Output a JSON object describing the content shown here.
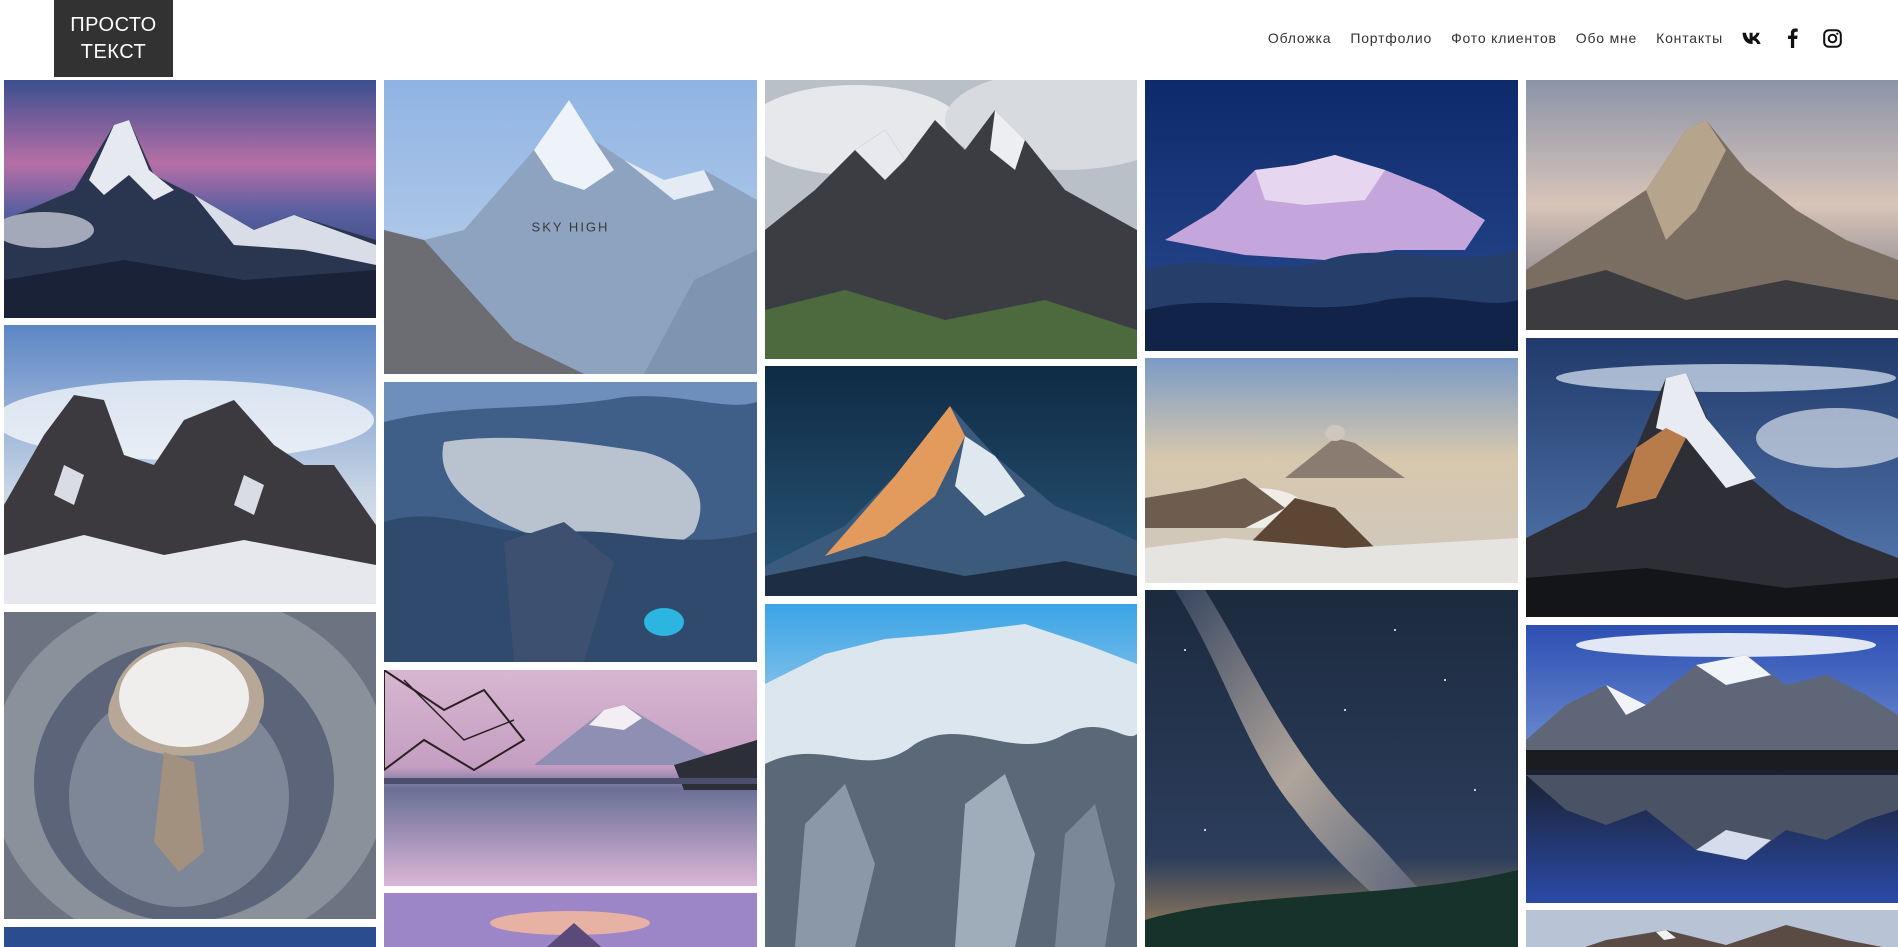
{
  "brand": {
    "line1": "ПРОСТО",
    "line2": "ТЕКСТ"
  },
  "nav": {
    "items": [
      {
        "label": "Обложка"
      },
      {
        "label": "Портфолио"
      },
      {
        "label": "Фото клиентов"
      },
      {
        "label": "Обо мне"
      },
      {
        "label": "Контакты"
      }
    ],
    "social": [
      {
        "icon": "vk-icon"
      },
      {
        "icon": "facebook-icon"
      },
      {
        "icon": "instagram-icon"
      }
    ]
  },
  "gallery": {
    "hover_caption": "SKY HIGH",
    "photos": [
      {
        "subject": "matterhorn-pink-sky"
      },
      {
        "subject": "ama-dablam"
      },
      {
        "subject": "cloudy-jagged-peaks"
      },
      {
        "subject": "pink-summit-above-clouds"
      },
      {
        "subject": "golden-ridge-peak"
      },
      {
        "subject": "dark-rocky-peaks"
      },
      {
        "subject": "aerial-mine-valley"
      },
      {
        "subject": "orange-lit-summit"
      },
      {
        "subject": "bromo-volcano"
      },
      {
        "subject": "matterhorn-evening"
      },
      {
        "subject": "volcano-eruption-aerial"
      },
      {
        "subject": "fuji-lake-reflection"
      },
      {
        "subject": "snowy-forest-mountain"
      },
      {
        "subject": "milky-way-night"
      },
      {
        "subject": "lake-mountain-reflection"
      },
      {
        "subject": "blue-sky-strip"
      },
      {
        "subject": "sunset-peak-strip"
      },
      {
        "subject": "snowy-range-strip"
      }
    ]
  }
}
